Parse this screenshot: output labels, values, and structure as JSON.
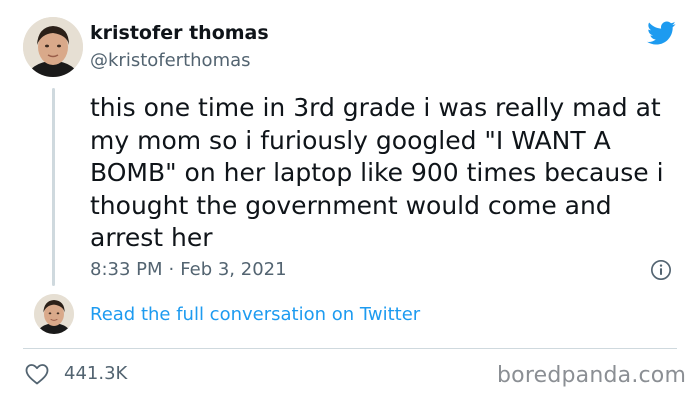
{
  "tweet": {
    "author_name": "kristofer thomas",
    "author_handle": "@kristoferthomas",
    "text": "this one time in 3rd grade i was really mad at my mom so i furiously googled \"I WANT A BOMB\" on her laptop like 900 times because i thought the government would come and arrest her",
    "time": "8:33 PM",
    "separator": "·",
    "date": "Feb 3, 2021",
    "read_conversation_label": "Read the full conversation on Twitter",
    "like_count": "441.3K"
  },
  "icons": {
    "brand": "twitter-bird-icon",
    "info": "info-icon",
    "like": "heart-icon"
  },
  "colors": {
    "twitter_blue": "#1d9bf0",
    "text_primary": "#0f1419",
    "text_secondary": "#536471",
    "divider": "#cfd9de"
  },
  "watermark": "boredpanda.com"
}
